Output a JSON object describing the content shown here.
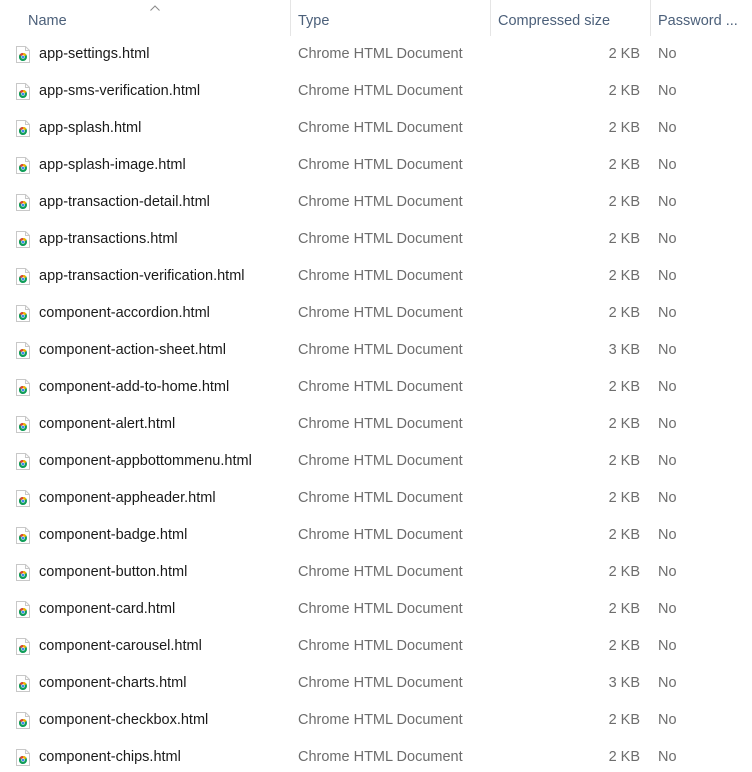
{
  "header": {
    "name": "Name",
    "type": "Type",
    "compressed_size": "Compressed size",
    "password": "Password ..."
  },
  "files": [
    {
      "name": "app-settings.html",
      "type": "Chrome HTML Document",
      "size": "2 KB",
      "password": "No",
      "icon": "chrome-html-file-icon"
    },
    {
      "name": "app-sms-verification.html",
      "type": "Chrome HTML Document",
      "size": "2 KB",
      "password": "No",
      "icon": "chrome-html-file-icon"
    },
    {
      "name": "app-splash.html",
      "type": "Chrome HTML Document",
      "size": "2 KB",
      "password": "No",
      "icon": "chrome-html-file-icon"
    },
    {
      "name": "app-splash-image.html",
      "type": "Chrome HTML Document",
      "size": "2 KB",
      "password": "No",
      "icon": "chrome-html-file-icon"
    },
    {
      "name": "app-transaction-detail.html",
      "type": "Chrome HTML Document",
      "size": "2 KB",
      "password": "No",
      "icon": "chrome-html-file-icon"
    },
    {
      "name": "app-transactions.html",
      "type": "Chrome HTML Document",
      "size": "2 KB",
      "password": "No",
      "icon": "chrome-html-file-icon"
    },
    {
      "name": "app-transaction-verification.html",
      "type": "Chrome HTML Document",
      "size": "2 KB",
      "password": "No",
      "icon": "chrome-html-file-icon"
    },
    {
      "name": "component-accordion.html",
      "type": "Chrome HTML Document",
      "size": "2 KB",
      "password": "No",
      "icon": "chrome-html-file-icon"
    },
    {
      "name": "component-action-sheet.html",
      "type": "Chrome HTML Document",
      "size": "3 KB",
      "password": "No",
      "icon": "chrome-html-file-icon"
    },
    {
      "name": "component-add-to-home.html",
      "type": "Chrome HTML Document",
      "size": "2 KB",
      "password": "No",
      "icon": "chrome-html-file-icon"
    },
    {
      "name": "component-alert.html",
      "type": "Chrome HTML Document",
      "size": "2 KB",
      "password": "No",
      "icon": "chrome-html-file-icon"
    },
    {
      "name": "component-appbottommenu.html",
      "type": "Chrome HTML Document",
      "size": "2 KB",
      "password": "No",
      "icon": "chrome-html-file-icon"
    },
    {
      "name": "component-appheader.html",
      "type": "Chrome HTML Document",
      "size": "2 KB",
      "password": "No",
      "icon": "chrome-html-file-icon"
    },
    {
      "name": "component-badge.html",
      "type": "Chrome HTML Document",
      "size": "2 KB",
      "password": "No",
      "icon": "chrome-html-file-icon"
    },
    {
      "name": "component-button.html",
      "type": "Chrome HTML Document",
      "size": "2 KB",
      "password": "No",
      "icon": "chrome-html-file-icon"
    },
    {
      "name": "component-card.html",
      "type": "Chrome HTML Document",
      "size": "2 KB",
      "password": "No",
      "icon": "chrome-html-file-icon"
    },
    {
      "name": "component-carousel.html",
      "type": "Chrome HTML Document",
      "size": "2 KB",
      "password": "No",
      "icon": "chrome-html-file-icon"
    },
    {
      "name": "component-charts.html",
      "type": "Chrome HTML Document",
      "size": "3 KB",
      "password": "No",
      "icon": "chrome-html-file-icon"
    },
    {
      "name": "component-checkbox.html",
      "type": "Chrome HTML Document",
      "size": "2 KB",
      "password": "No",
      "icon": "chrome-html-file-icon"
    },
    {
      "name": "component-chips.html",
      "type": "Chrome HTML Document",
      "size": "2 KB",
      "password": "No",
      "icon": "chrome-html-file-icon"
    }
  ],
  "colors": {
    "header_text": "#4c607a",
    "name_text": "#1a1a1a",
    "secondary_text": "#6d6d6d",
    "chrome_red": "#db4437",
    "chrome_yellow": "#f4b400",
    "chrome_green": "#0f9d58",
    "chrome_blue": "#4285f4"
  }
}
